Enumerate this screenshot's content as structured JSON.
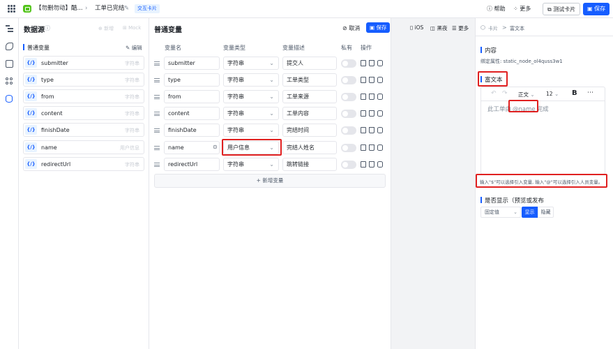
{
  "topbar": {
    "app_name": "【勿删勿动】酷...",
    "card_title": "工单已完结",
    "badge": "交互卡片",
    "help": "帮助",
    "more": "更多",
    "test_card": "测试卡片",
    "save": "保存"
  },
  "datasource": {
    "title": "数据源",
    "add": "新增",
    "mock": "Mock",
    "section": "普通变量",
    "edit": "编辑",
    "items": [
      {
        "name": "submitter",
        "type": "字符串"
      },
      {
        "name": "type",
        "type": "字符串"
      },
      {
        "name": "from",
        "type": "字符串"
      },
      {
        "name": "content",
        "type": "字符串"
      },
      {
        "name": "finishDate",
        "type": "字符串"
      },
      {
        "name": "name",
        "type": "用户信息"
      },
      {
        "name": "redirectUrl",
        "type": "字符串"
      }
    ]
  },
  "variables": {
    "title": "普通变量",
    "cancel": "取消",
    "save": "保存",
    "headers": {
      "name": "变量名",
      "type": "变量类型",
      "desc": "变量描述",
      "private": "私有",
      "ops": "操作"
    },
    "rows": [
      {
        "name": "submitter",
        "type": "字符串",
        "desc": "提交人"
      },
      {
        "name": "type",
        "type": "字符串",
        "desc": "工单类型"
      },
      {
        "name": "from",
        "type": "字符串",
        "desc": "工单来源"
      },
      {
        "name": "content",
        "type": "字符串",
        "desc": "工单内容"
      },
      {
        "name": "finishDate",
        "type": "字符串",
        "desc": "完结时间"
      },
      {
        "name": "name",
        "type": "用户信息",
        "desc": "完结人姓名"
      },
      {
        "name": "redirectUrl",
        "type": "字符串",
        "desc": "跳转链接"
      }
    ],
    "add_variable": "新增变量"
  },
  "canvas": {
    "ios": "iOS",
    "night": "黑夜",
    "more": "更多"
  },
  "inspector": {
    "crumb_card": "卡片",
    "crumb_sep": ">",
    "crumb_rich": "富文本",
    "content_title": "内容",
    "bound_attr": "绑定属性: static_node_ol4quss3w1",
    "richtext_title": "富文本",
    "font_style": "正文",
    "font_size": "12",
    "bold": "B",
    "editor_prefix": "此工单由",
    "editor_mention": "@name",
    "editor_suffix": "完成",
    "hint": "输入\"$\"可以选择引入变量, 输入\"@\"可以选择引入人员变量。",
    "display_title": "是否显示（预览或发布",
    "fixed_value": "固定值",
    "show": "显示",
    "hide": "隐藏"
  },
  "colors": {
    "accent": "#165dff",
    "highlight": "#e02020"
  }
}
